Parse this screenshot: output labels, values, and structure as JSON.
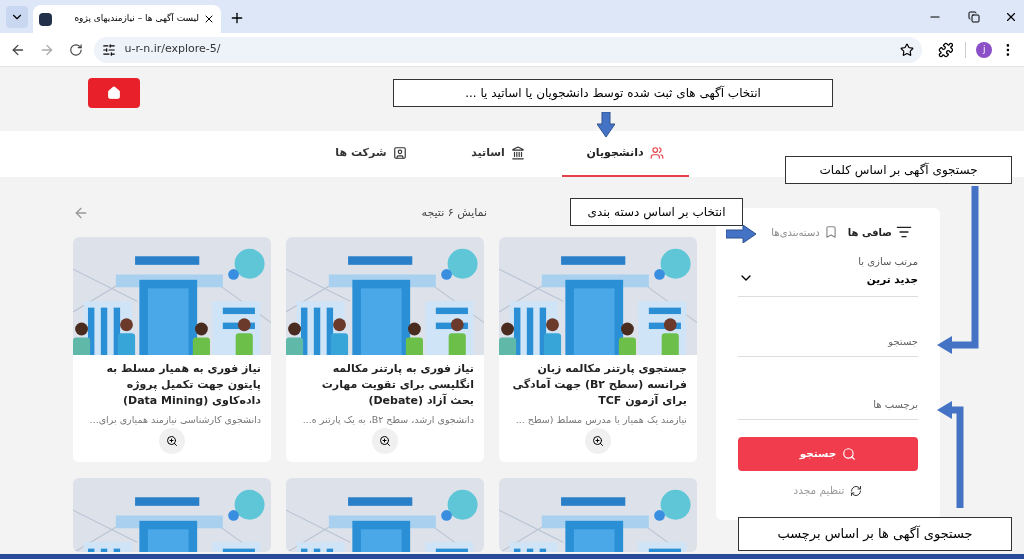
{
  "browser": {
    "tab_title": "لیست آگهی ها – نیازمندیهای پژوه",
    "url": "u-r-n.ir/explore-5/",
    "profile_initial": "j"
  },
  "nav_tabs": [
    {
      "label": "دانشجویان",
      "kind": "students",
      "selected": true
    },
    {
      "label": "اساتید",
      "kind": "professors",
      "selected": false
    },
    {
      "label": "شرکت ها",
      "kind": "companies",
      "selected": false
    }
  ],
  "results": {
    "count_label": "نمایش ۶ نتیجه"
  },
  "cards": [
    {
      "kind": "full",
      "title": "جستجوی پارتنر مکالمه زبان فرانسه (سطح B۲) جهت آمادگی برای آزمون TCF",
      "description": "نیازمند یک همیار یا مدرس مسلط (سطح ..."
    },
    {
      "kind": "full",
      "title": "نیاز فوری به پارتنر مکالمه انگلیسی برای تقویت مهارت بحث آزاد (Debate)",
      "description": "دانشجوی ارشد، سطح B۲، به یک پارتنر ه..."
    },
    {
      "kind": "full",
      "title": "نیاز فوری به همیار مسلط به پایتون جهت تکمیل پروژه داده‌کاوی (Data Mining)",
      "description": "دانشجوی کارشناسی نیازمند همیاری برای..."
    },
    {
      "kind": "image"
    },
    {
      "kind": "image"
    },
    {
      "kind": "image"
    }
  ],
  "sidebar": {
    "tabs": [
      {
        "label": "صافی ها",
        "kind": "filter",
        "selected": true
      },
      {
        "label": "دسته‌بندی‌ها",
        "kind": "categories",
        "selected": false
      }
    ],
    "sort": {
      "label": "مرتب سازی با",
      "value": "جدید ترین"
    },
    "search_field": {
      "placeholder": "جستجو"
    },
    "tags_field": {
      "placeholder": "برچسب ها"
    },
    "search_button": "جستجو",
    "reset_link": "تنظیم مجدد"
  },
  "annotations": [
    {
      "text": "انتخاب آگهی های ثبت شده توسط دانشجویان یا اساتید یا ..."
    },
    {
      "text": "جستجوی آگهی بر اساس کلمات"
    },
    {
      "text": "انتخاب بر اساس دسته بندی"
    },
    {
      "text": "جستجوی آگهی ها بر اساس برچسب"
    }
  ]
}
